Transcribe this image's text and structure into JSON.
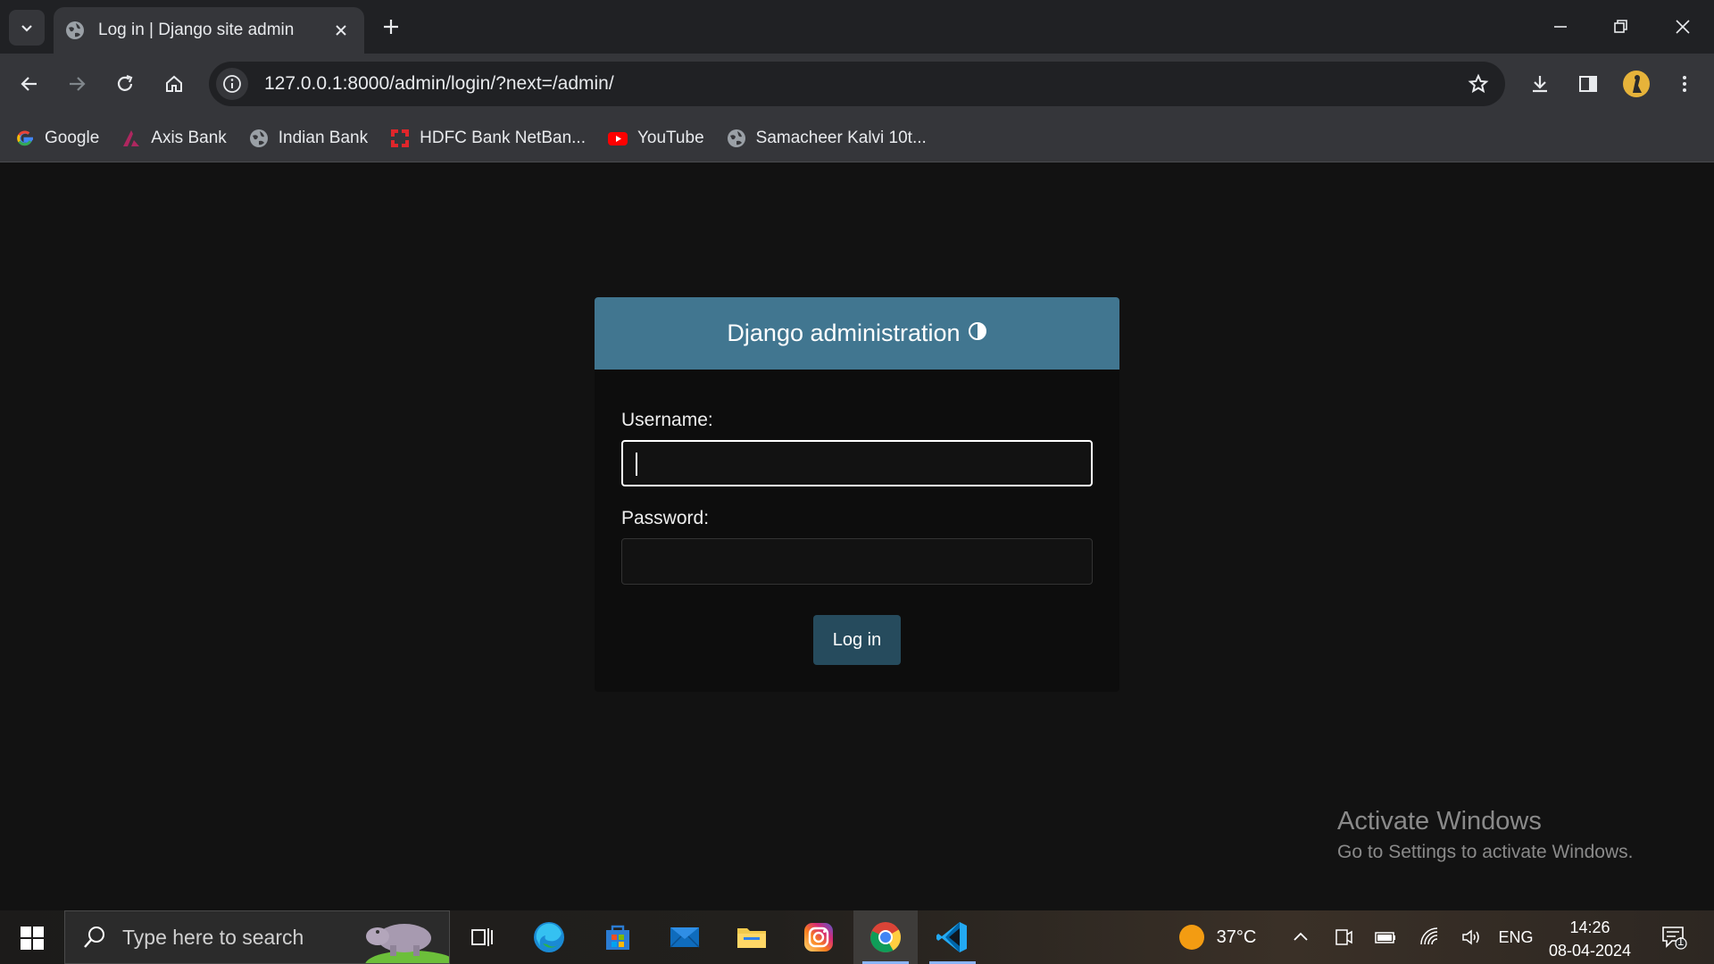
{
  "browser": {
    "tab_title": "Log in | Django site admin",
    "url": "127.0.0.1:8000/admin/login/?next=/admin/",
    "bookmarks": [
      {
        "label": "Google",
        "icon": "google-icon"
      },
      {
        "label": "Axis Bank",
        "icon": "axis-bank-icon"
      },
      {
        "label": "Indian Bank",
        "icon": "globe-icon"
      },
      {
        "label": "HDFC Bank NetBan...",
        "icon": "hdfc-icon"
      },
      {
        "label": "YouTube",
        "icon": "youtube-icon"
      },
      {
        "label": "Samacheer Kalvi 10t...",
        "icon": "globe-icon"
      }
    ]
  },
  "login": {
    "site_name": "Django administration",
    "username_label": "Username:",
    "username_value": "",
    "password_label": "Password:",
    "password_value": "",
    "submit_label": "Log in"
  },
  "watermark": {
    "line1": "Activate Windows",
    "line2": "Go to Settings to activate Windows."
  },
  "taskbar": {
    "search_placeholder": "Type here to search",
    "weather_temp": "37°C",
    "language": "ENG",
    "time": "14:26",
    "date": "08-04-2024",
    "notification_count": "1"
  },
  "colors": {
    "header_bg": "#417690",
    "button_bg": "#264b5d",
    "page_bg": "#121212"
  }
}
